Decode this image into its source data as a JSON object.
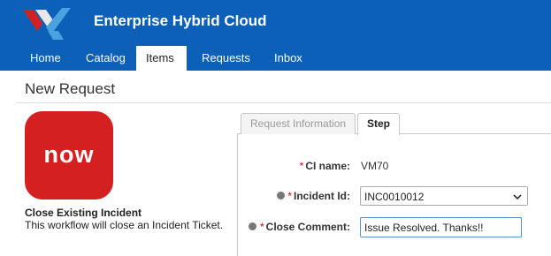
{
  "header": {
    "title": "Enterprise Hybrid Cloud",
    "logo_icon": "vmware-logo-icon",
    "bg_color": "#0c60b8"
  },
  "nav": {
    "tabs": [
      {
        "label": "Home",
        "active": false
      },
      {
        "label": "Catalog",
        "active": false
      },
      {
        "label": "Items",
        "active": true
      },
      {
        "label": "Requests",
        "active": false
      },
      {
        "label": "Inbox",
        "active": false
      }
    ]
  },
  "page": {
    "title": "New Request"
  },
  "catalog_item": {
    "icon_text": "now",
    "icon_color": "#d42020",
    "name": "Close Existing Incident",
    "description": "This workflow will close an Incident Ticket."
  },
  "form": {
    "tabs": [
      {
        "label": "Request Information",
        "active": false
      },
      {
        "label": "Step",
        "active": true
      }
    ],
    "fields": {
      "ci_name": {
        "label": "CI name:",
        "value": "VM70",
        "required": true
      },
      "incident_id": {
        "label": "Incident Id:",
        "value": "INC0010012",
        "required": true
      },
      "close_comment": {
        "label": "Close Comment:",
        "value": "Issue Resolved. Thanks!!",
        "required": true
      }
    }
  }
}
